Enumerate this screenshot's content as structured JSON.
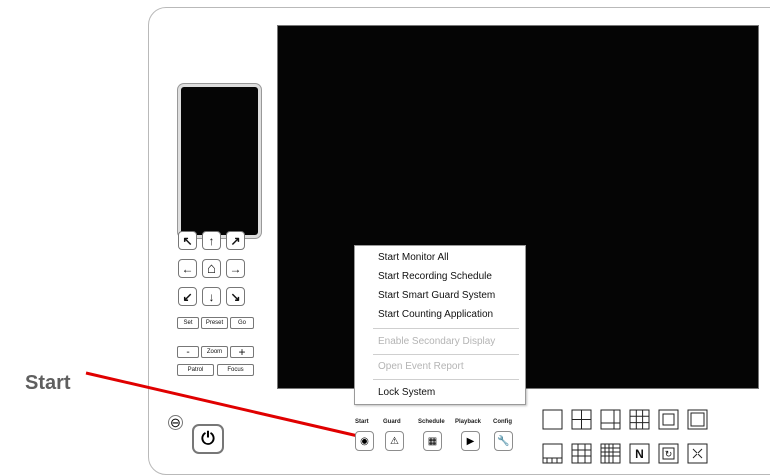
{
  "callout": {
    "label": "Start"
  },
  "ptz": {
    "arrows": [
      "↖",
      "↑",
      "↗",
      "←",
      "⌂",
      "→",
      "↙",
      "↓",
      "↘"
    ],
    "set": "Set",
    "preset": "Preset",
    "go": "Go",
    "minus": "-",
    "zoom": "Zoom",
    "plus": "+",
    "patrol": "Patrol",
    "focus": "Focus"
  },
  "menu": {
    "items": [
      {
        "label": "Start Monitor All",
        "enabled": true
      },
      {
        "label": "Start Recording Schedule",
        "enabled": true
      },
      {
        "label": "Start Smart Guard System",
        "enabled": true
      },
      {
        "label": "Start Counting Application",
        "enabled": true
      },
      {
        "label": "Enable Secondary Display",
        "enabled": false
      },
      {
        "label": "Open Event Report",
        "enabled": false
      },
      {
        "label": "Lock System",
        "enabled": true
      }
    ]
  },
  "toolbar": {
    "labels": [
      "Start",
      "Guard",
      "Schedule",
      "Playback",
      "Config"
    ],
    "icons": [
      "record-icon",
      "warning-icon",
      "schedule-icon",
      "playback-icon",
      "wrench-icon"
    ]
  },
  "power": {
    "minus": "⊖",
    "power": "⏻"
  },
  "layouts": {
    "row1": [
      "single-view-icon",
      "quad-view-icon",
      "six-view-icon",
      "nine-view-icon",
      "thirteen-view-icon",
      "sixteen-view-icon"
    ],
    "row2": [
      "twenty-view-icon",
      "twenty-five-view-icon",
      "thirty-six-view-icon",
      "n-view-icon",
      "cycle-view-icon",
      "fullscreen-icon"
    ],
    "n_label": "N"
  },
  "colors": {
    "callout_line": "#e00000",
    "background": "#ffffff",
    "video": "#050505"
  }
}
